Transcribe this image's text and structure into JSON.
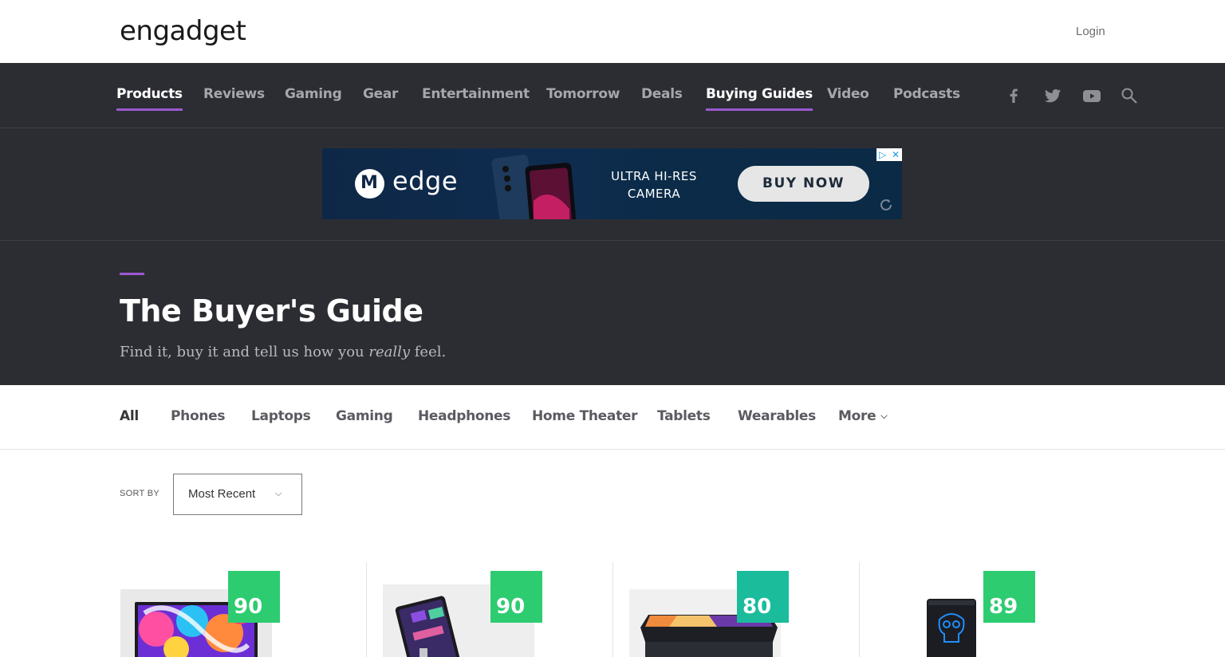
{
  "header": {
    "logo": "engadget",
    "login_label": "Login"
  },
  "nav": {
    "items": [
      {
        "label": "Products",
        "active": true
      },
      {
        "label": "Reviews",
        "active": false
      },
      {
        "label": "Gaming",
        "active": false
      },
      {
        "label": "Gear",
        "active": false
      },
      {
        "label": "Entertainment",
        "active": false
      },
      {
        "label": "Tomorrow",
        "active": false
      },
      {
        "label": "Deals",
        "active": false
      },
      {
        "label": "Buying Guides",
        "active": true
      },
      {
        "label": "Video",
        "active": false
      },
      {
        "label": "Podcasts",
        "active": false
      }
    ],
    "social_icons": [
      "facebook-icon",
      "twitter-icon",
      "youtube-icon",
      "search-icon"
    ]
  },
  "ad": {
    "brand": "edge",
    "tagline_line1": "ULTRA HI-RES",
    "tagline_line2": "CAMERA",
    "cta": "BUY NOW",
    "choices_icon": "adchoices-icon",
    "close_icon": "close-icon",
    "refresh_icon": "refresh-icon"
  },
  "hero": {
    "title": "The Buyer's Guide",
    "subtitle_before": "Find it, buy it and tell us how you ",
    "subtitle_em": "really",
    "subtitle_after": " feel."
  },
  "categories": {
    "items": [
      "All",
      "Phones",
      "Laptops",
      "Gaming",
      "Headphones",
      "Home Theater",
      "Tablets",
      "Wearables",
      "More"
    ],
    "active": "All"
  },
  "sort": {
    "label": "SORT BY",
    "value": "Most Recent"
  },
  "products": [
    {
      "score": "90",
      "score_color": "#2ecc71",
      "image": "mac-studio-display"
    },
    {
      "score": "90",
      "score_color": "#2ecc71",
      "image": "ipad-on-stand"
    },
    {
      "score": "80",
      "score_color": "#1abc9c",
      "image": "iphone-se"
    },
    {
      "score": "89",
      "score_color": "#2ecc71",
      "image": "intel-nuc"
    }
  ],
  "colors": {
    "accent": "#9b59d0",
    "dark_bg": "#2c2d33"
  }
}
